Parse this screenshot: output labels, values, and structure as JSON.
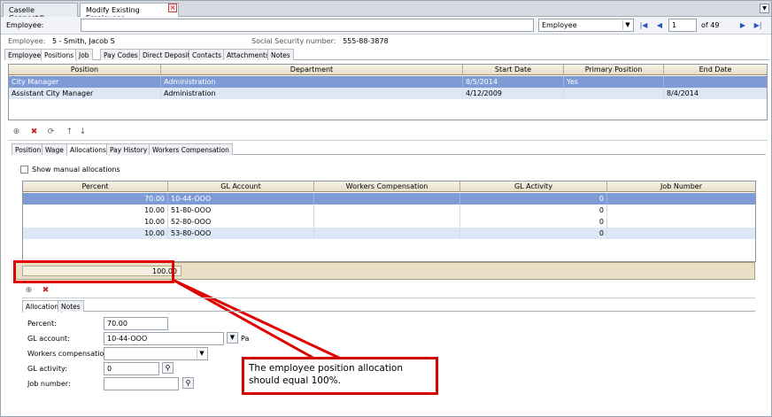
{
  "doc_tabs": [
    {
      "label": "Caselle Connect®"
    },
    {
      "label": "Modify Existing Employees"
    }
  ],
  "employee_row": {
    "label": "Employee:",
    "value": "",
    "lookup_select": "Employee",
    "page": "1",
    "of_label": "of 49"
  },
  "info": {
    "employee_label": "Employee:",
    "employee_value": "5 - Smith, Jacob S",
    "ssn_label": "Social Security number:",
    "ssn_value": "555-88-3878"
  },
  "main_tabs": [
    "Employee",
    "Positions",
    "Job",
    "Pay Codes",
    "Direct Deposit",
    "Contacts",
    "Attachments",
    "Notes"
  ],
  "positions_grid": {
    "columns": [
      "Position",
      "Department",
      "Start Date",
      "Primary Position",
      "End Date"
    ],
    "rows": [
      [
        "City Manager",
        "Administration",
        "8/5/2014",
        "Yes",
        ""
      ],
      [
        "Assistant City Manager",
        "Administration",
        "4/12/2009",
        "",
        "8/4/2014"
      ]
    ]
  },
  "sub_tabs": [
    "Position",
    "Wage",
    "Allocations",
    "Pay History",
    "Workers Compensation"
  ],
  "show_manual_label": "Show manual allocations",
  "alloc_grid": {
    "columns": [
      "Percent",
      "GL Account",
      "Workers Compensation",
      "GL Activity",
      "Job Number"
    ],
    "rows": [
      [
        "70.00",
        "10-44-OOO",
        "",
        "0",
        ""
      ],
      [
        "10.00",
        "51-80-OOO",
        "",
        "0",
        ""
      ],
      [
        "10.00",
        "52-80-OOO",
        "",
        "0",
        ""
      ],
      [
        "10.00",
        "53-80-OOO",
        "",
        "0",
        ""
      ]
    ],
    "total": "100.00"
  },
  "detail_tabs": [
    "Allocation",
    "Notes"
  ],
  "form": {
    "percent_label": "Percent:",
    "percent_value": "70.00",
    "gl_account_label": "GL account:",
    "gl_account_value": "10-44-OOO",
    "gl_account_trailing": "Pa",
    "workers_comp_label": "Workers compensation:",
    "workers_comp_value": "",
    "gl_activity_label": "GL activity:",
    "gl_activity_value": "0",
    "job_number_label": "Job number:",
    "job_number_value": ""
  },
  "callout": {
    "text": "The employee position allocation should equal 100%."
  },
  "colors": {
    "selected_row": "#7e9bd6",
    "alt_row": "#dde7f5",
    "highlight": "#e00000"
  }
}
